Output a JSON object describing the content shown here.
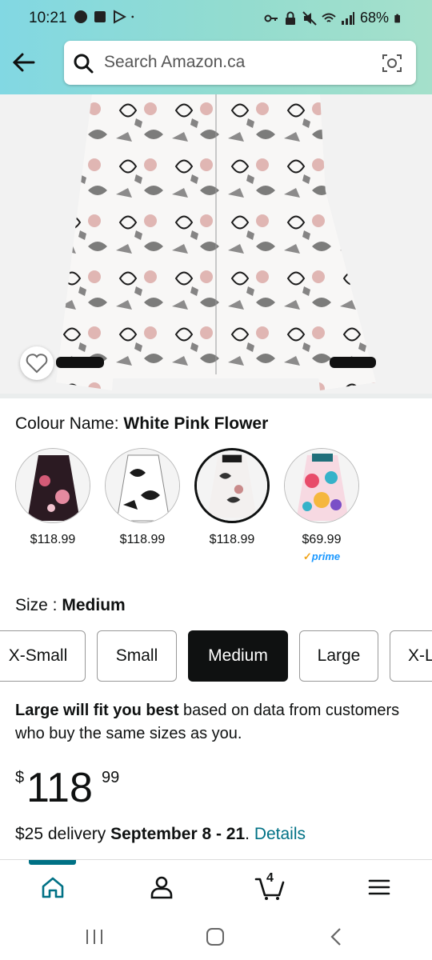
{
  "status": {
    "time": "10:21",
    "battery": "68%"
  },
  "search": {
    "placeholder": "Search Amazon.ca"
  },
  "product": {
    "colour_label": "Colour Name:",
    "colour_value": "White Pink Flower",
    "swatches": [
      {
        "price": "$118.99",
        "prime": "",
        "colors": [
          "#2b1a22",
          "#d35b77"
        ]
      },
      {
        "price": "$118.99",
        "prime": "",
        "colors": [
          "#ffffff",
          "#1a1a1a"
        ]
      },
      {
        "price": "$118.99",
        "prime": "",
        "colors": [
          "#f3f0ef",
          "#c98a8a"
        ],
        "selected": true
      },
      {
        "price": "$69.99",
        "prime": "prime",
        "colors": [
          "#e84b6a",
          "#36b2c9"
        ]
      }
    ],
    "size_label": "Size :",
    "size_value": "Medium",
    "sizes": [
      "X-Small",
      "Small",
      "Medium",
      "Large",
      "X-L"
    ],
    "selected_size": "Medium",
    "fit_bold": "Large will fit you best",
    "fit_rest": " based on data from customers who buy the same sizes as you.",
    "price": {
      "currency": "$",
      "whole": "118",
      "fraction": "99"
    },
    "delivery_prefix": "$25 delivery ",
    "delivery_date": "September 8 - 21",
    "delivery_suffix": ". ",
    "details_link": "Details"
  },
  "bottom_nav": {
    "cart_count": "4"
  },
  "accent": "#007185"
}
